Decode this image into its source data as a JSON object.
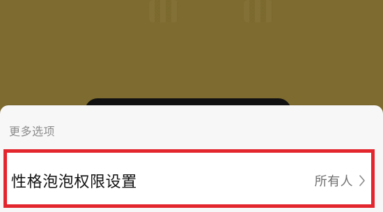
{
  "sheet": {
    "title": "更多选项",
    "option": {
      "label": "性格泡泡权限设置",
      "value": "所有人"
    }
  },
  "icons": {
    "chevron": "chevron-right-icon"
  },
  "colors": {
    "highlight_border": "#e3252e",
    "background": "#7d6b2f"
  }
}
